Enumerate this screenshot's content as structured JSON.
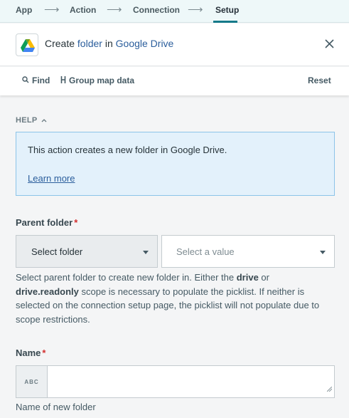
{
  "stepper": {
    "steps": [
      {
        "label": "App"
      },
      {
        "label": "Action"
      },
      {
        "label": "Connection"
      },
      {
        "label": "Setup"
      }
    ],
    "active_step": "Setup"
  },
  "header": {
    "title_prefix": "Create ",
    "title_object": "folder",
    "title_mid": " in ",
    "title_app": "Google Drive",
    "app_icon": "google-drive-icon",
    "close_icon": "close-icon"
  },
  "toolbar": {
    "find_label": "Find",
    "find_icon": "search-icon",
    "group_label": "Group map data",
    "group_icon": "group-bracket-icon",
    "reset_label": "Reset"
  },
  "help": {
    "label": "HELP",
    "text": "This action creates a new folder in Google Drive.",
    "link": "Learn more"
  },
  "parent_folder": {
    "label": "Parent folder",
    "required_mark": "*",
    "mode_value": "Select folder",
    "value_placeholder": "Select a value",
    "hint_1": "Select parent folder to create new folder in. Either the ",
    "hint_bold_1": "drive",
    "hint_2": " or",
    "hint_bold_2": "drive.readonly",
    "hint_3": " scope is necessary to populate the picklist. If neither is selected on the connection setup page, the picklist will not populate due to scope restrictions."
  },
  "name_field": {
    "label": "Name",
    "required_mark": "*",
    "type_badge": "ABC",
    "value": "",
    "hint": "Name of new folder"
  },
  "colors": {
    "accent": "#157a8a",
    "link": "#2b5e9c",
    "help_bg": "#e3f1fb",
    "help_border": "#8cc4e8",
    "required": "#d32f2f"
  }
}
